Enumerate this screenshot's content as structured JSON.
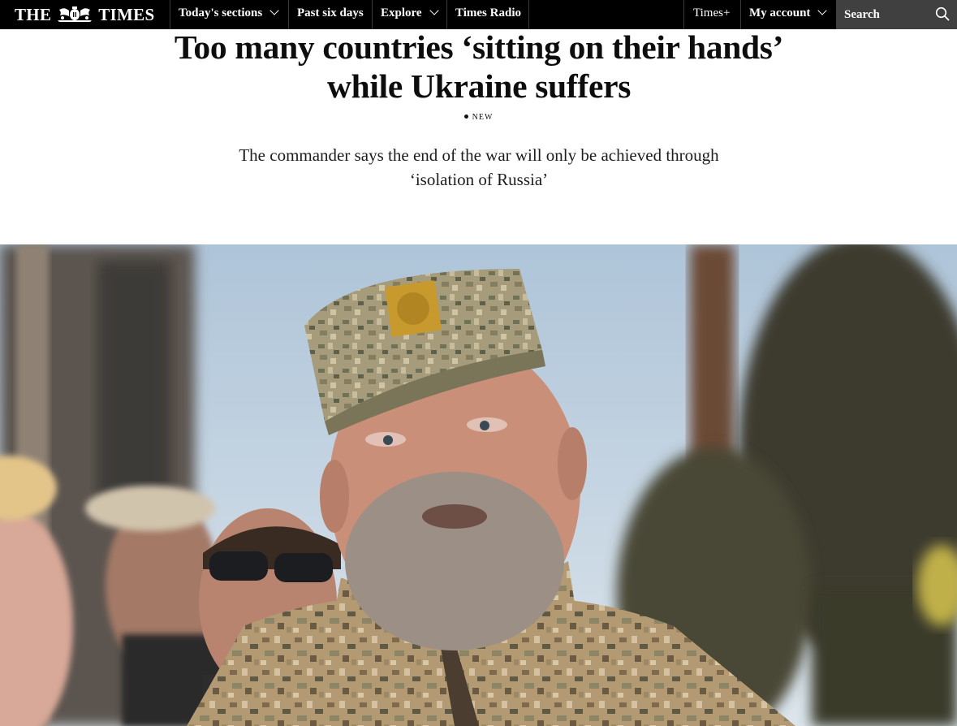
{
  "nav": {
    "logo_left": "THE",
    "logo_right": "TIMES",
    "items": [
      {
        "label": "Today's sections",
        "has_dropdown": true
      },
      {
        "label": "Past six days",
        "has_dropdown": false
      },
      {
        "label": "Explore",
        "has_dropdown": true
      },
      {
        "label": "Times Radio",
        "has_dropdown": false
      }
    ],
    "right_items": [
      {
        "label": "Times+",
        "has_dropdown": false
      },
      {
        "label": "My account",
        "has_dropdown": true
      }
    ],
    "search": {
      "placeholder": "Search",
      "icon": "search-icon"
    }
  },
  "article": {
    "headline": "Too many countries ‘sitting on their hands’ while Ukraine suffers",
    "badge": "NEW",
    "standfirst": "The commander says the end of the war will only be achieved through ‘isolation of Russia’"
  },
  "colors": {
    "nav_bg": "#000000",
    "search_bg": "#404040",
    "text": "#0d0d0d"
  }
}
